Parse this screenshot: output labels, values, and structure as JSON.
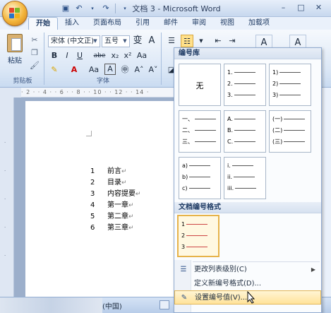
{
  "window": {
    "title": "文档 3 - Microsoft Word",
    "controls": [
      "–",
      "□",
      "✕"
    ]
  },
  "quick_access": [
    "save-icon",
    "undo-icon",
    "redo-icon"
  ],
  "tabs": [
    {
      "label": "开始",
      "active": true
    },
    {
      "label": "插入"
    },
    {
      "label": "页面布局"
    },
    {
      "label": "引用"
    },
    {
      "label": "邮件"
    },
    {
      "label": "审阅"
    },
    {
      "label": "视图"
    },
    {
      "label": "加载项"
    }
  ],
  "ribbon": {
    "paste_label": "粘贴",
    "clipboard_label": "剪贴板",
    "font_label": "字体",
    "font_name": "宋体 (中文正)",
    "font_size": "五号",
    "format_buttons": [
      "B",
      "I",
      "U",
      "abe",
      "x₂",
      "x²"
    ],
    "style_glyph": "A"
  },
  "document": {
    "list": [
      {
        "num": "1",
        "text": "前言"
      },
      {
        "num": "2",
        "text": "目录"
      },
      {
        "num": "3",
        "text": "内容提要"
      },
      {
        "num": "4",
        "text": "第一章"
      },
      {
        "num": "5",
        "text": "第二章"
      },
      {
        "num": "6",
        "text": "第三章"
      }
    ],
    "para_mark": "↵"
  },
  "statusbar": {
    "language": "(中国)"
  },
  "numbering_menu": {
    "library_header": "编号库",
    "none_label": "无",
    "library": [
      [
        "1.",
        "2.",
        "3."
      ],
      [
        "1)",
        "2)",
        "3)"
      ],
      [
        "一、",
        "二、",
        "三、"
      ],
      [
        "A.",
        "B.",
        "C."
      ],
      [
        "(一)",
        "(二)",
        "(三)"
      ],
      [
        "a)",
        "b)",
        "c)"
      ],
      [
        "i.",
        "ii.",
        "iii."
      ]
    ],
    "document_header": "文档编号格式",
    "document_format": [
      "1",
      "2",
      "3"
    ],
    "items": [
      {
        "label": "更改列表级别(C)",
        "has_submenu": true
      },
      {
        "label": "定义新编号格式(D)..."
      },
      {
        "label": "设置编号值(V)..."
      }
    ]
  }
}
